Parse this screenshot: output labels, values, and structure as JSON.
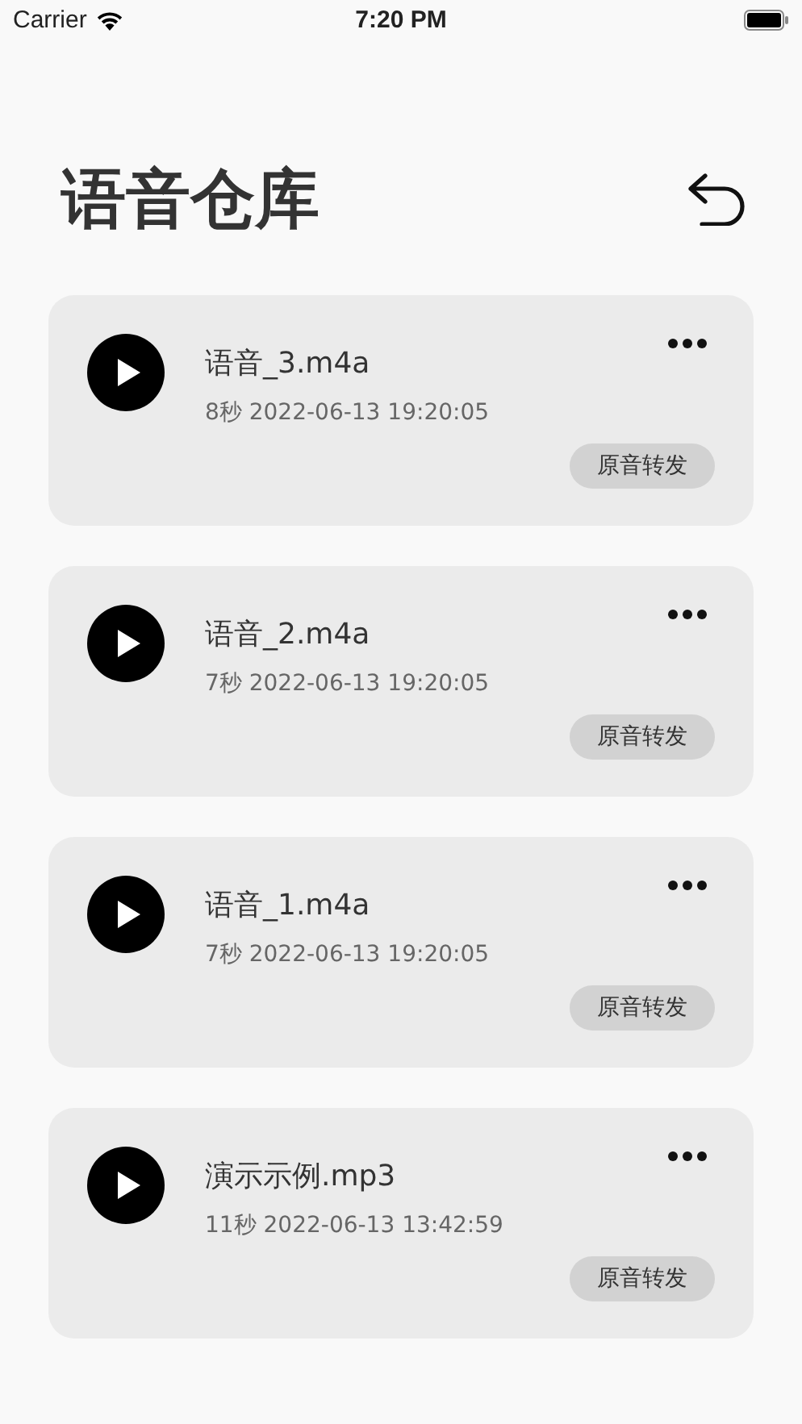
{
  "status_bar": {
    "carrier": "Carrier",
    "time": "7:20 PM"
  },
  "header": {
    "title": "语音仓库"
  },
  "recordings": [
    {
      "name": "语音_3.m4a",
      "meta": "8秒 2022-06-13 19:20:05",
      "action": "原音转发"
    },
    {
      "name": "语音_2.m4a",
      "meta": "7秒 2022-06-13 19:20:05",
      "action": "原音转发"
    },
    {
      "name": "语音_1.m4a",
      "meta": "7秒 2022-06-13 19:20:05",
      "action": "原音转发"
    },
    {
      "name": "演示示例.mp3",
      "meta": "11秒 2022-06-13 13:42:59",
      "action": "原音转发"
    }
  ]
}
